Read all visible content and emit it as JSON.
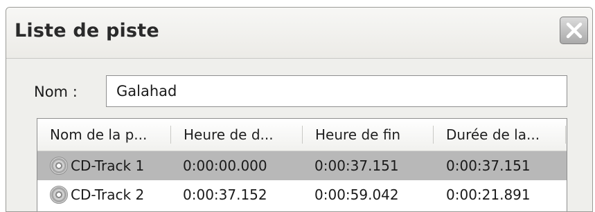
{
  "window": {
    "title": "Liste de piste"
  },
  "form": {
    "name_label": "Nom :",
    "name_value": "Galahad"
  },
  "table": {
    "columns": [
      "Nom de la p...",
      "Heure de d...",
      "Heure de fin",
      "Durée de la..."
    ],
    "rows": [
      {
        "name": "CD-Track 1",
        "start": "0:00:00.000",
        "end": "0:00:37.151",
        "duration": "0:00:37.151",
        "selected": true,
        "icon": "cd-icon"
      },
      {
        "name": "CD-Track 2",
        "start": "0:00:37.152",
        "end": "0:00:59.042",
        "duration": "0:00:21.891",
        "selected": false,
        "icon": "cd-icon"
      }
    ]
  },
  "icons": {
    "close": "close-icon"
  }
}
